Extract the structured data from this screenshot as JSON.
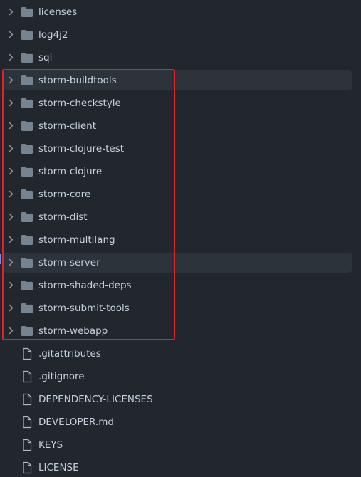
{
  "colors": {
    "background": "#22272e",
    "row_highlight": "#2d333b",
    "text": "#c5d1de",
    "folder_icon": "#768390",
    "annotation_border": "#e5202a"
  },
  "items": [
    {
      "name": "licenses",
      "type": "folder",
      "icon": "folder-icon"
    },
    {
      "name": "log4j2",
      "type": "folder",
      "icon": "folder-icon"
    },
    {
      "name": "sql",
      "type": "folder",
      "icon": "folder-icon"
    },
    {
      "name": "storm-buildtools",
      "type": "folder",
      "icon": "folder-icon",
      "highlighted": true
    },
    {
      "name": "storm-checkstyle",
      "type": "folder",
      "icon": "folder-icon"
    },
    {
      "name": "storm-client",
      "type": "folder",
      "icon": "folder-icon"
    },
    {
      "name": "storm-clojure-test",
      "type": "folder",
      "icon": "folder-icon"
    },
    {
      "name": "storm-clojure",
      "type": "folder",
      "icon": "folder-icon"
    },
    {
      "name": "storm-core",
      "type": "folder",
      "icon": "folder-icon"
    },
    {
      "name": "storm-dist",
      "type": "folder",
      "icon": "folder-icon"
    },
    {
      "name": "storm-multilang",
      "type": "folder",
      "icon": "folder-icon"
    },
    {
      "name": "storm-server",
      "type": "folder",
      "icon": "folder-icon",
      "highlighted": true
    },
    {
      "name": "storm-shaded-deps",
      "type": "folder",
      "icon": "folder-icon"
    },
    {
      "name": "storm-submit-tools",
      "type": "folder",
      "icon": "folder-icon"
    },
    {
      "name": "storm-webapp",
      "type": "folder",
      "icon": "folder-icon"
    },
    {
      "name": ".gitattributes",
      "type": "file",
      "icon": "file-icon"
    },
    {
      "name": ".gitignore",
      "type": "file",
      "icon": "file-icon"
    },
    {
      "name": "DEPENDENCY-LICENSES",
      "type": "file",
      "icon": "file-icon"
    },
    {
      "name": "DEVELOPER.md",
      "type": "file",
      "icon": "file-icon"
    },
    {
      "name": "KEYS",
      "type": "file",
      "icon": "file-icon"
    },
    {
      "name": "LICENSE",
      "type": "file",
      "icon": "file-icon"
    }
  ]
}
